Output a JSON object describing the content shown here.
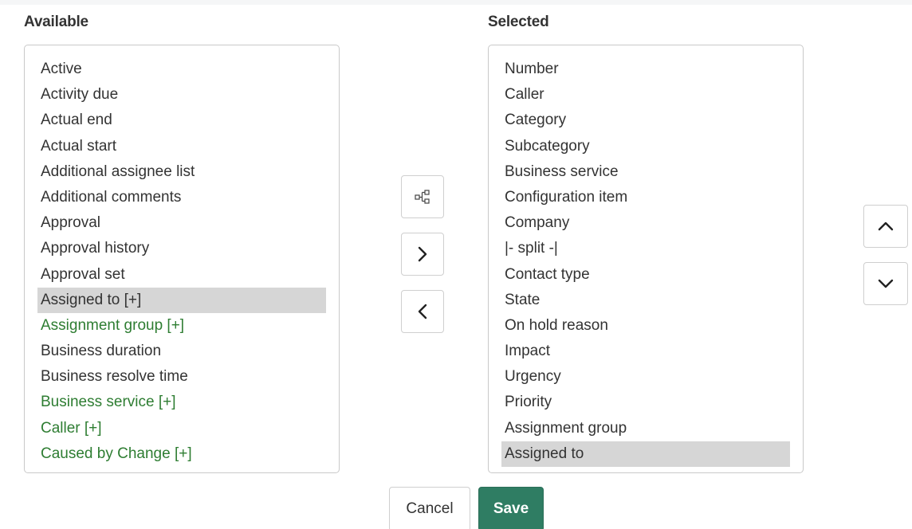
{
  "available": {
    "heading": "Available",
    "items": [
      {
        "label": "Active",
        "ref": false,
        "selected": false
      },
      {
        "label": "Activity due",
        "ref": false,
        "selected": false
      },
      {
        "label": "Actual end",
        "ref": false,
        "selected": false
      },
      {
        "label": "Actual start",
        "ref": false,
        "selected": false
      },
      {
        "label": "Additional assignee list",
        "ref": false,
        "selected": false
      },
      {
        "label": "Additional comments",
        "ref": false,
        "selected": false
      },
      {
        "label": "Approval",
        "ref": false,
        "selected": false
      },
      {
        "label": "Approval history",
        "ref": false,
        "selected": false
      },
      {
        "label": "Approval set",
        "ref": false,
        "selected": false
      },
      {
        "label": "Assigned to [+]",
        "ref": false,
        "selected": true
      },
      {
        "label": "Assignment group [+]",
        "ref": true,
        "selected": false
      },
      {
        "label": "Business duration",
        "ref": false,
        "selected": false
      },
      {
        "label": "Business resolve time",
        "ref": false,
        "selected": false
      },
      {
        "label": "Business service [+]",
        "ref": true,
        "selected": false
      },
      {
        "label": "Caller [+]",
        "ref": true,
        "selected": false
      },
      {
        "label": "Caused by Change [+]",
        "ref": true,
        "selected": false
      }
    ]
  },
  "selected": {
    "heading": "Selected",
    "items": [
      {
        "label": "Number",
        "selected": false
      },
      {
        "label": "Caller",
        "selected": false
      },
      {
        "label": "Category",
        "selected": false
      },
      {
        "label": "Subcategory",
        "selected": false
      },
      {
        "label": "Business service",
        "selected": false
      },
      {
        "label": "Configuration item",
        "selected": false
      },
      {
        "label": "Company",
        "selected": false
      },
      {
        "label": "|- split -|",
        "selected": false
      },
      {
        "label": "Contact type",
        "selected": false
      },
      {
        "label": "State",
        "selected": false
      },
      {
        "label": "On hold reason",
        "selected": false
      },
      {
        "label": "Impact",
        "selected": false
      },
      {
        "label": "Urgency",
        "selected": false
      },
      {
        "label": "Priority",
        "selected": false
      },
      {
        "label": "Assignment group",
        "selected": false
      },
      {
        "label": "Assigned to",
        "selected": true
      }
    ]
  },
  "controls": {
    "tree_icon": "tree-hierarchy-icon",
    "add_icon": "chevron-right-icon",
    "remove_icon": "chevron-left-icon",
    "up_icon": "chevron-up-icon",
    "down_icon": "chevron-down-icon"
  },
  "actions": {
    "cancel_label": "Cancel",
    "save_label": "Save"
  },
  "colors": {
    "reference_field": "#2e7d32",
    "selected_row": "#d6d6d6",
    "save_button": "#2f7d63"
  }
}
